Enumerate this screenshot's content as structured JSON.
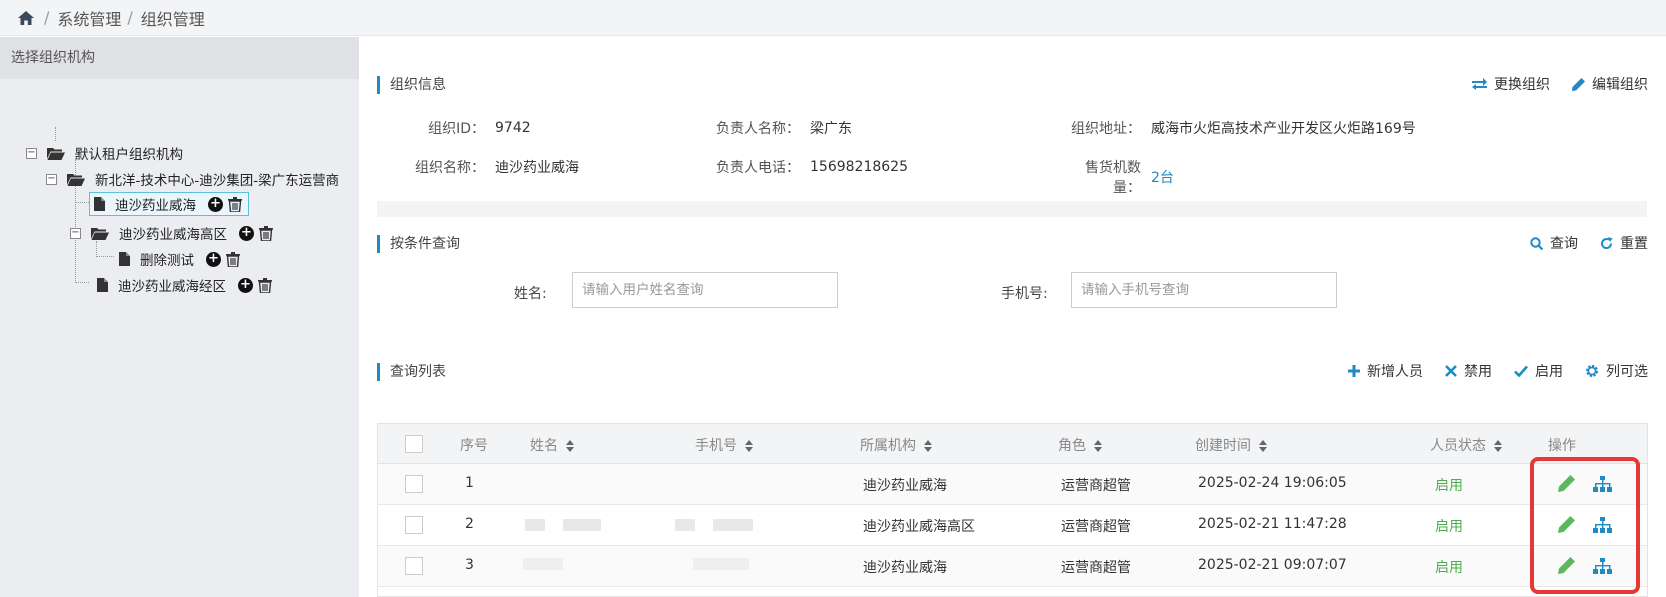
{
  "breadcrumb": {
    "items": [
      "系统管理",
      "组织管理"
    ]
  },
  "left_panel": {
    "header": "选择组织机构",
    "tree": [
      {
        "label": "默认租户组织机构"
      },
      {
        "label": "新北洋-技术中心-迪沙集团-梁广东运营商"
      },
      {
        "label": "迪沙药业威海",
        "selected": true
      },
      {
        "label": "迪沙药业威海高区"
      },
      {
        "label": "删除测试"
      },
      {
        "label": "迪沙药业威海经区"
      }
    ]
  },
  "org_info": {
    "title": "组织信息",
    "actions": {
      "change": "更换组织",
      "edit": "编辑组织"
    },
    "fields": {
      "org_id_label": "组织ID：",
      "org_id": "9742",
      "leader_name_label": "负责人名称：",
      "leader_name": "梁广东",
      "address_label": "组织地址：",
      "address": "威海市火炬高技术产业开发区火炬路169号",
      "org_name_label": "组织名称：",
      "org_name": "迪沙药业威海",
      "leader_phone_label": "负责人电话：",
      "leader_phone": "15698218625",
      "machines_label": "售货机数量：",
      "machines": "2台"
    }
  },
  "query": {
    "title": "按条件查询",
    "actions": {
      "search": "查询",
      "reset": "重置"
    },
    "name_label": "姓名:",
    "name_placeholder": "请输入用户姓名查询",
    "phone_label": "手机号:",
    "phone_placeholder": "请输入手机号查询"
  },
  "list": {
    "title": "查询列表",
    "actions": {
      "add": "新增人员",
      "disable": "禁用",
      "enable": "启用",
      "columns": "列可选"
    },
    "columns": [
      "序号",
      "姓名",
      "手机号",
      "所属机构",
      "角色",
      "创建时间",
      "人员状态",
      "操作"
    ],
    "rows": [
      {
        "index": "1",
        "name": "",
        "phone": "",
        "org": "迪沙药业威海",
        "role": "运营商超管",
        "created": "2025-02-24 19:06:05",
        "status": "启用"
      },
      {
        "index": "2",
        "name": "",
        "phone": "",
        "org": "迪沙药业威海高区",
        "role": "运营商超管",
        "created": "2025-02-21 11:47:28",
        "status": "启用"
      },
      {
        "index": "3",
        "name": "",
        "phone": "",
        "org": "迪沙药业威海",
        "role": "运营商超管",
        "created": "2025-02-21 09:07:07",
        "status": "启用"
      }
    ]
  },
  "icons": {
    "home": "home-icon",
    "folder": "folder-open-icon",
    "file": "file-icon",
    "add": "plus-circle-icon",
    "delete": "trash-icon",
    "swap": "swap-icon",
    "edit": "pencil-icon",
    "search": "search-icon",
    "refresh": "refresh-icon",
    "plus": "plus-icon",
    "ban": "times-icon",
    "check": "check-icon",
    "gear": "gear-icon",
    "sitemap": "sitemap-icon",
    "sort": "sort-icon"
  },
  "colors": {
    "accent": "#1f8ac4",
    "status_enabled": "#4cae4c",
    "edit_icon": "#5cb85c",
    "highlight": "#e53935"
  }
}
